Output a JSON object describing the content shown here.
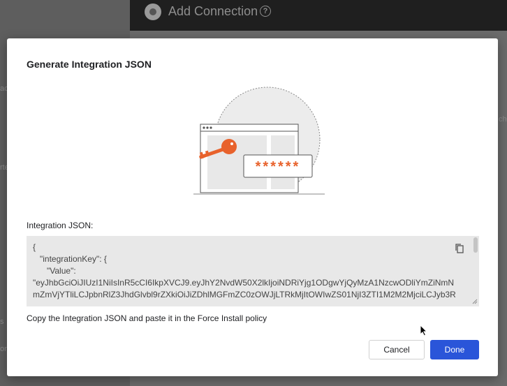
{
  "background": {
    "title": "Add Connection",
    "help_glyph": "?",
    "fragments": [
      "ac",
      "rte",
      "s",
      "ch",
      "on"
    ]
  },
  "dialog": {
    "title": "Generate Integration JSON",
    "password_mask": "******",
    "section_label": "Integration JSON:",
    "json_value": "{\n   \"integrationKey\": {\n      \"Value\":\n\"eyJhbGciOiJIUzI1NiIsInR5cCI6IkpXVCJ9.eyJhY2NvdW50X2lkIjoiNDRiYjg1ODgwYjQyMzA1NzcwODliYmZiNmN\nmZmVjYTliLCJpbnRlZ3JhdGlvbl9rZXkiOiJiZDhlMGFmZC0zOWJjLTRkMjItOWIwZS01NjI3ZTI1M2M2MjciLCJyb3R",
    "copy_icon": "copy-icon",
    "hint": "Copy the Integration JSON and paste it in the Force Install policy",
    "cancel_label": "Cancel",
    "done_label": "Done"
  },
  "colors": {
    "accent": "#2a55d9",
    "key_orange": "#e8622c"
  }
}
